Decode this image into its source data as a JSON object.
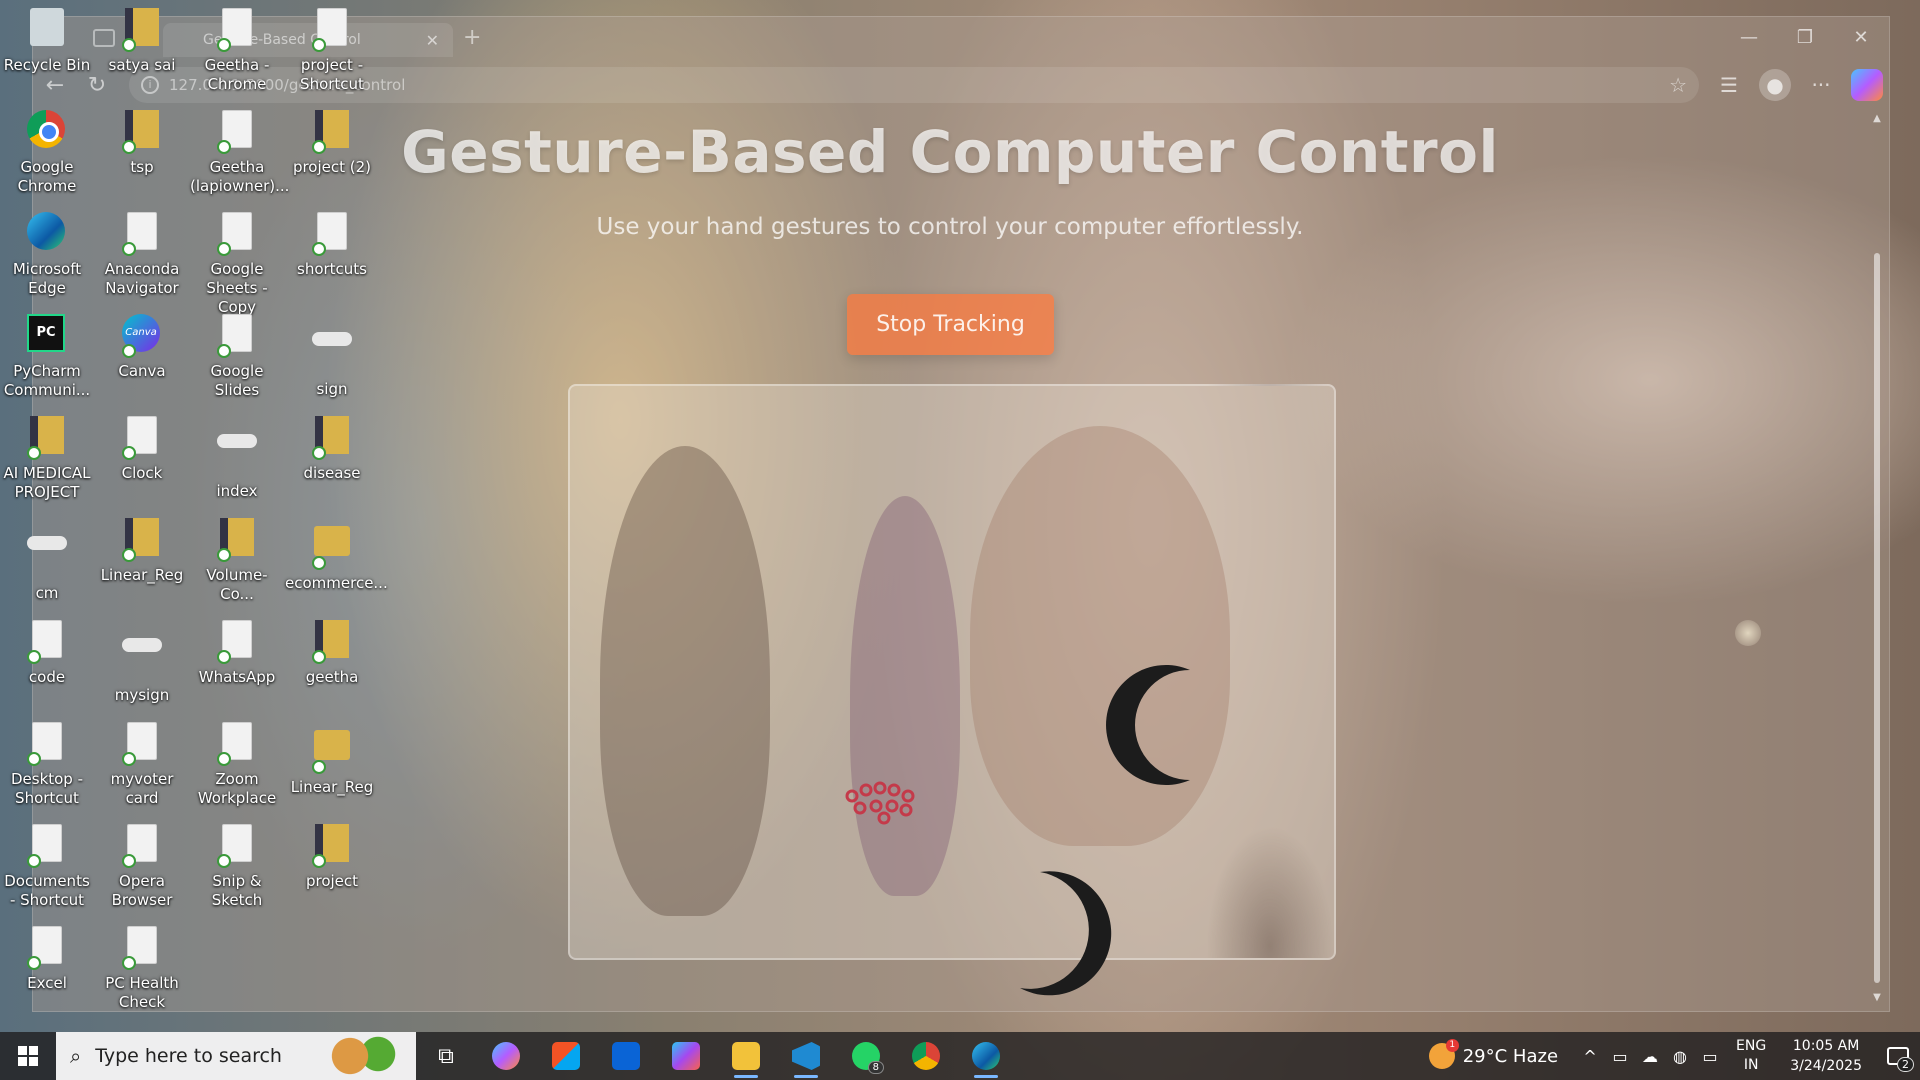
{
  "browser": {
    "tab_title": "Gesture-Based Control",
    "url": "127.0.0.1:5000/gesture_control",
    "window_controls": [
      "—",
      "❐",
      "✕"
    ]
  },
  "page": {
    "title": "Gesture-Based Computer Control",
    "subtitle": "Use your hand gestures to control your computer effortlessly.",
    "stop_button": "Stop Tracking"
  },
  "desktop_icons": [
    {
      "label": "Recycle Bin",
      "type": "recycle"
    },
    {
      "label": "satya sai",
      "type": "zip"
    },
    {
      "label": "Geetha - Chrome",
      "type": "file"
    },
    {
      "label": "project - Shortcut",
      "type": "file"
    },
    {
      "label": "Google Chrome",
      "type": "chrome"
    },
    {
      "label": "tsp",
      "type": "zip"
    },
    {
      "label": "Geetha (lapiowner)...",
      "type": "file"
    },
    {
      "label": "project (2)",
      "type": "zip"
    },
    {
      "label": "Microsoft Edge",
      "type": "edge"
    },
    {
      "label": "Anaconda Navigator",
      "type": "file"
    },
    {
      "label": "Google Sheets - Copy",
      "type": "file"
    },
    {
      "label": "shortcuts",
      "type": "file"
    },
    {
      "label": "PyCharm Communi...",
      "type": "pycharm"
    },
    {
      "label": "Canva",
      "type": "canva"
    },
    {
      "label": "Google Slides",
      "type": "file"
    },
    {
      "label": "sign",
      "type": "cloud"
    },
    {
      "label": "AI MEDICAL PROJECT",
      "type": "zip"
    },
    {
      "label": "Clock",
      "type": "file"
    },
    {
      "label": "index",
      "type": "cloud"
    },
    {
      "label": "disease",
      "type": "zip"
    },
    {
      "label": "cm",
      "type": "cloud"
    },
    {
      "label": "Linear_Reg",
      "type": "zip"
    },
    {
      "label": "Volume-Co...",
      "type": "zip"
    },
    {
      "label": "ecommerce...",
      "type": "folder"
    },
    {
      "label": "code",
      "type": "file"
    },
    {
      "label": "mysign",
      "type": "cloud"
    },
    {
      "label": "WhatsApp",
      "type": "file"
    },
    {
      "label": "geetha",
      "type": "zip"
    },
    {
      "label": "Desktop - Shortcut",
      "type": "file"
    },
    {
      "label": "myvoter card",
      "type": "file"
    },
    {
      "label": "Zoom Workplace",
      "type": "file"
    },
    {
      "label": "Linear_Reg",
      "type": "folder"
    },
    {
      "label": "Documents - Shortcut",
      "type": "file"
    },
    {
      "label": "Opera Browser",
      "type": "file"
    },
    {
      "label": "Snip & Sketch",
      "type": "file"
    },
    {
      "label": "project",
      "type": "zip"
    },
    {
      "label": "Excel",
      "type": "file"
    },
    {
      "label": "PC Health Check",
      "type": "file"
    }
  ],
  "taskbar": {
    "search_placeholder": "Type here to search",
    "whatsapp_badge": "8",
    "weather_badge": "1",
    "weather": "29°C  Haze",
    "lang_line1": "ENG",
    "lang_line2": "IN",
    "time": "10:05 AM",
    "date": "3/24/2025",
    "notification_count": "2"
  }
}
